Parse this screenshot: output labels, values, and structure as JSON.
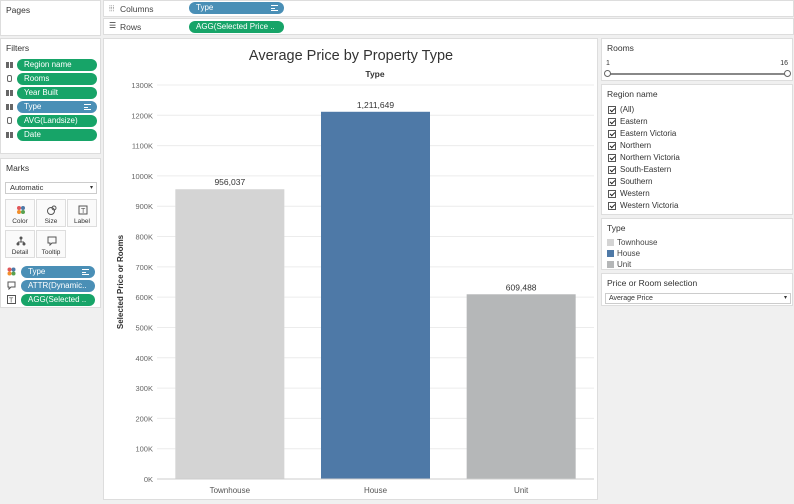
{
  "pages": {
    "title": "Pages"
  },
  "shelves": {
    "columns_label": "Columns",
    "columns_pill": "Type",
    "rows_label": "Rows",
    "rows_pill": "AGG(Selected Price .."
  },
  "filters": {
    "title": "Filters",
    "items": [
      "Region name",
      "Rooms",
      "Year Built",
      "Type",
      "AVG(Landsize)",
      "Date"
    ]
  },
  "marks": {
    "title": "Marks",
    "mark_type": "Automatic",
    "buttons": [
      "Color",
      "Size",
      "Label",
      "Detail",
      "Tooltip"
    ],
    "pills": [
      "Type",
      "ATTR(Dynamic..",
      "AGG(Selected .."
    ]
  },
  "chart_title": "Average Price by Property Type",
  "chart_data": {
    "type": "bar",
    "title": "Average Price by Property Type",
    "header": "Type",
    "categories": [
      "Townhouse",
      "House",
      "Unit"
    ],
    "values": [
      956037,
      1211649,
      609488
    ],
    "value_labels": [
      "956,037",
      "1,211,649",
      "609,488"
    ],
    "colors": [
      "#d4d4d4",
      "#4e79a7",
      "#b5b7b8"
    ],
    "ylabel": "Selected Price or Rooms",
    "ylim": [
      0,
      1300000
    ],
    "yticks": [
      "0K",
      "100K",
      "200K",
      "300K",
      "400K",
      "500K",
      "600K",
      "700K",
      "800K",
      "900K",
      "1000K",
      "1100K",
      "1200K",
      "1300K"
    ],
    "grid": true
  },
  "rooms": {
    "title": "Rooms",
    "min": "1",
    "max": "16"
  },
  "region": {
    "title": "Region name",
    "items": [
      "(All)",
      "Eastern",
      "Eastern Victoria",
      "Northern",
      "Northern Victoria",
      "South-Eastern",
      "Southern",
      "Western",
      "Western Victoria"
    ]
  },
  "type_legend": {
    "title": "Type",
    "items": [
      {
        "label": "Townhouse",
        "color": "#d4d4d4"
      },
      {
        "label": "House",
        "color": "#4e79a7"
      },
      {
        "label": "Unit",
        "color": "#b5b7b8"
      }
    ]
  },
  "price_selection": {
    "title": "Price or Room selection",
    "value": "Average Price"
  }
}
